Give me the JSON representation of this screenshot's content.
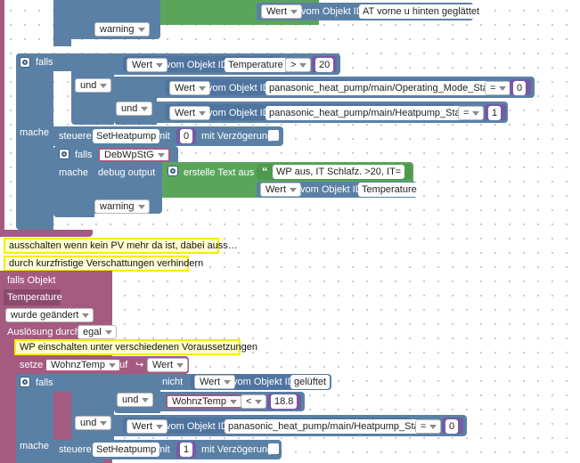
{
  "top": {
    "wert_label": "Wert",
    "vom_objekt_id_label": "vom Objekt ID",
    "object_id": "AT vorne u hinten geglättet",
    "warning_level": "warning"
  },
  "block1": {
    "falls_label": "falls",
    "mache_label": "mache",
    "cond1": {
      "wert": "Wert",
      "vom": "vom Objekt ID",
      "object_id": "Temperature",
      "operator": ">",
      "value": "20"
    },
    "und1": "und",
    "cond2": {
      "wert": "Wert",
      "vom": "vom Objekt ID",
      "object_id": "panasonic_heat_pump/main/Operating_Mode_State",
      "operator": "=",
      "value": "0"
    },
    "und2": "und",
    "cond3": {
      "wert": "Wert",
      "vom": "vom Objekt ID",
      "object_id": "panasonic_heat_pump/main/Heatpump_State",
      "operator": "=",
      "value": "1"
    },
    "steuere_label": "steuere",
    "steuere_target": "SetHeatpump",
    "mit_label": "mit",
    "steuere_value": "0",
    "verzoegerung_label": "mit Verzögerung",
    "inner_falls_label": "falls",
    "inner_var": "DebWpStG",
    "inner_mache_label": "mache",
    "debug_output_label": "debug output",
    "erstelle_text_label": "erstelle Text aus",
    "text_value": "WP aus, IT Schlafz. >20, IT=",
    "text_wert": "Wert",
    "text_vom": "vom Objekt ID",
    "text_object_id": "Temperature",
    "warning_level": "warning"
  },
  "comments": {
    "c1": "ausschalten wenn kein PV mehr da ist, dabei auss…",
    "c2": "durch kurzfristige Verschattungen verhindern",
    "c3": "WP einschalten unter verschiedenen Voraussetzungen"
  },
  "trigger": {
    "falls_objekt_label": "falls Objekt",
    "object_name": "Temperature",
    "changed": "wurde geändert",
    "ausloesung_label": "Auslösung durch",
    "ausloesung_value": "egal"
  },
  "setze": {
    "setze_label": "setze",
    "variable": "WohnzTemp",
    "auf_label": "auf",
    "wert": "Wert"
  },
  "block2": {
    "falls_label": "falls",
    "mache_label": "mache",
    "nicht_label": "nicht",
    "cond1": {
      "wert": "Wert",
      "vom": "vom Objekt ID",
      "object_id": "gelüftet"
    },
    "und1": "und",
    "cond2": {
      "variable": "WohnzTemp",
      "operator": "<",
      "value": "18.8"
    },
    "und2": "und",
    "cond3": {
      "wert": "Wert",
      "vom": "vom Objekt ID",
      "object_id": "panasonic_heat_pump/main/Heatpump_State",
      "operator": "=",
      "value": "0"
    },
    "steuere_label": "steuere",
    "steuere_target": "SetHeatpump",
    "mit_label": "mit",
    "steuere_value": "1",
    "verzoegerung_label": "mit Verzögerung"
  },
  "colors": {
    "trigger_pink": "#a55b80",
    "logic_blue": "#5b80a5",
    "text_green": "#5ba55b",
    "math_purple": "#745ba5",
    "comment_yellow": "#feffcc",
    "comment_border": "#f6ec00"
  }
}
